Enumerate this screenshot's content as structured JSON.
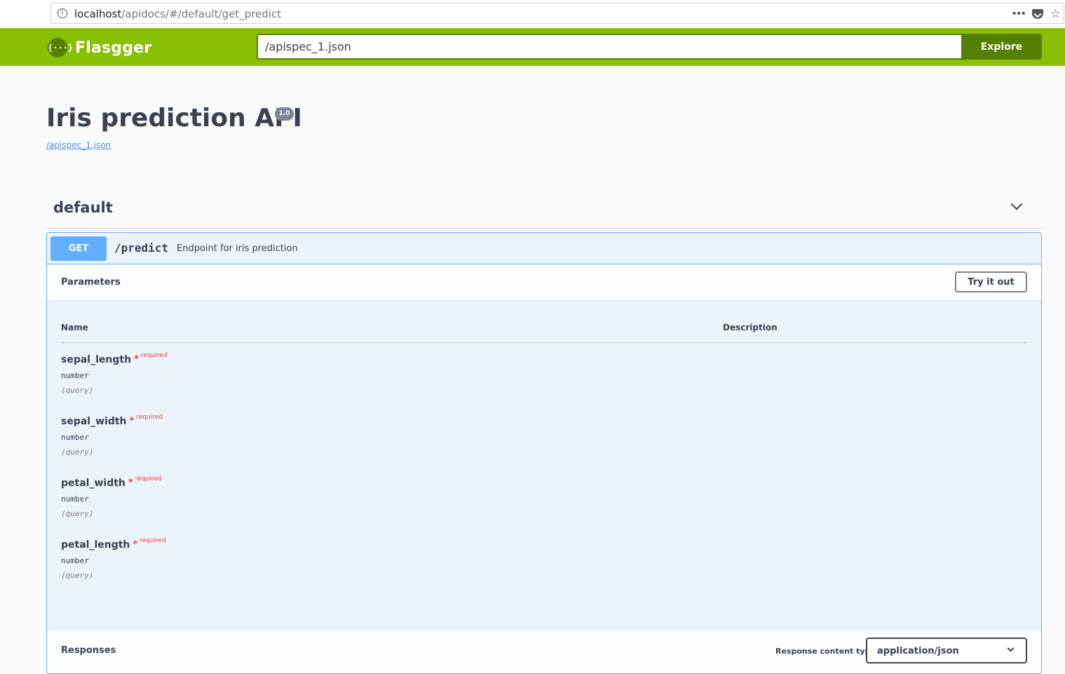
{
  "browser": {
    "url_host": "localhost",
    "url_path": "/apidocs/#/default/get_predict",
    "info_icon": "info-icon",
    "menu_icon": "dots-icon",
    "pocket_icon": "pocket-icon",
    "star_icon": "star-icon"
  },
  "topbar": {
    "logo_glyph": "{···}",
    "logo_text": "Flasgger",
    "spec_url_value": "/apispec_1.json",
    "explore_label": "Explore",
    "colors": {
      "bar": "#89bf04",
      "dark": "#547f00"
    }
  },
  "info": {
    "title": "Iris prediction API",
    "version": "1.0",
    "spec_link": "/apispec_1.json"
  },
  "tag": {
    "name": "default"
  },
  "operation": {
    "method": "GET",
    "path": "/predict",
    "summary": "Endpoint for iris prediction",
    "parameters_title": "Parameters",
    "try_label": "Try it out",
    "columns": {
      "name": "Name",
      "description": "Description"
    },
    "params": [
      {
        "name": "sepal_length",
        "star": "*",
        "required": "required",
        "type": "number",
        "in": "(query)"
      },
      {
        "name": "sepal_width",
        "star": "*",
        "required": "required",
        "type": "number",
        "in": "(query)"
      },
      {
        "name": "petal_width",
        "star": "*",
        "required": "required",
        "type": "number",
        "in": "(query)"
      },
      {
        "name": "petal_length",
        "star": "*",
        "required": "required",
        "type": "number",
        "in": "(query)"
      }
    ],
    "responses_title": "Responses",
    "content_type_label": "Response content type",
    "content_type_value": "application/json",
    "colors": {
      "get": "#61affe",
      "block_bg": "#ebf3fb",
      "required": "#ff3b3b"
    }
  }
}
